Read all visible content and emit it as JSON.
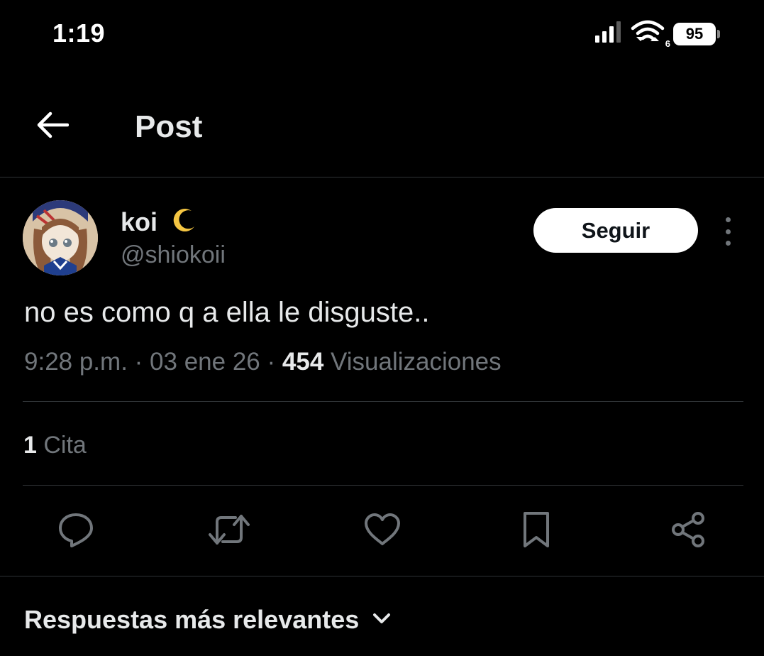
{
  "status_bar": {
    "time": "1:19",
    "network": "6",
    "battery": "95"
  },
  "header": {
    "title": "Post",
    "back_icon": "arrow-left-icon"
  },
  "post": {
    "author": {
      "display_name": "koi",
      "emoji": "crescent-moon-icon",
      "handle": "@shiokoii"
    },
    "follow_label": "Seguir",
    "text": "no es como q a ella le disguste..",
    "time": "9:28 p.m.",
    "date": "03 ene 26",
    "separator": "·",
    "views_count": "454",
    "views_label": "Visualizaciones",
    "quotes_count": "1",
    "quotes_label": "Cita"
  },
  "actions": [
    {
      "name": "reply",
      "icon": "reply-icon"
    },
    {
      "name": "repost",
      "icon": "repost-icon"
    },
    {
      "name": "like",
      "icon": "heart-icon"
    },
    {
      "name": "bookmark",
      "icon": "bookmark-icon"
    },
    {
      "name": "share",
      "icon": "share-icon"
    }
  ],
  "replies": {
    "sort_label": "Respuestas más relevantes"
  },
  "colors": {
    "background": "#000000",
    "text_primary": "#e7e9ea",
    "text_secondary": "#71767b",
    "divider": "#2f3336",
    "moon": "#f4c542"
  }
}
